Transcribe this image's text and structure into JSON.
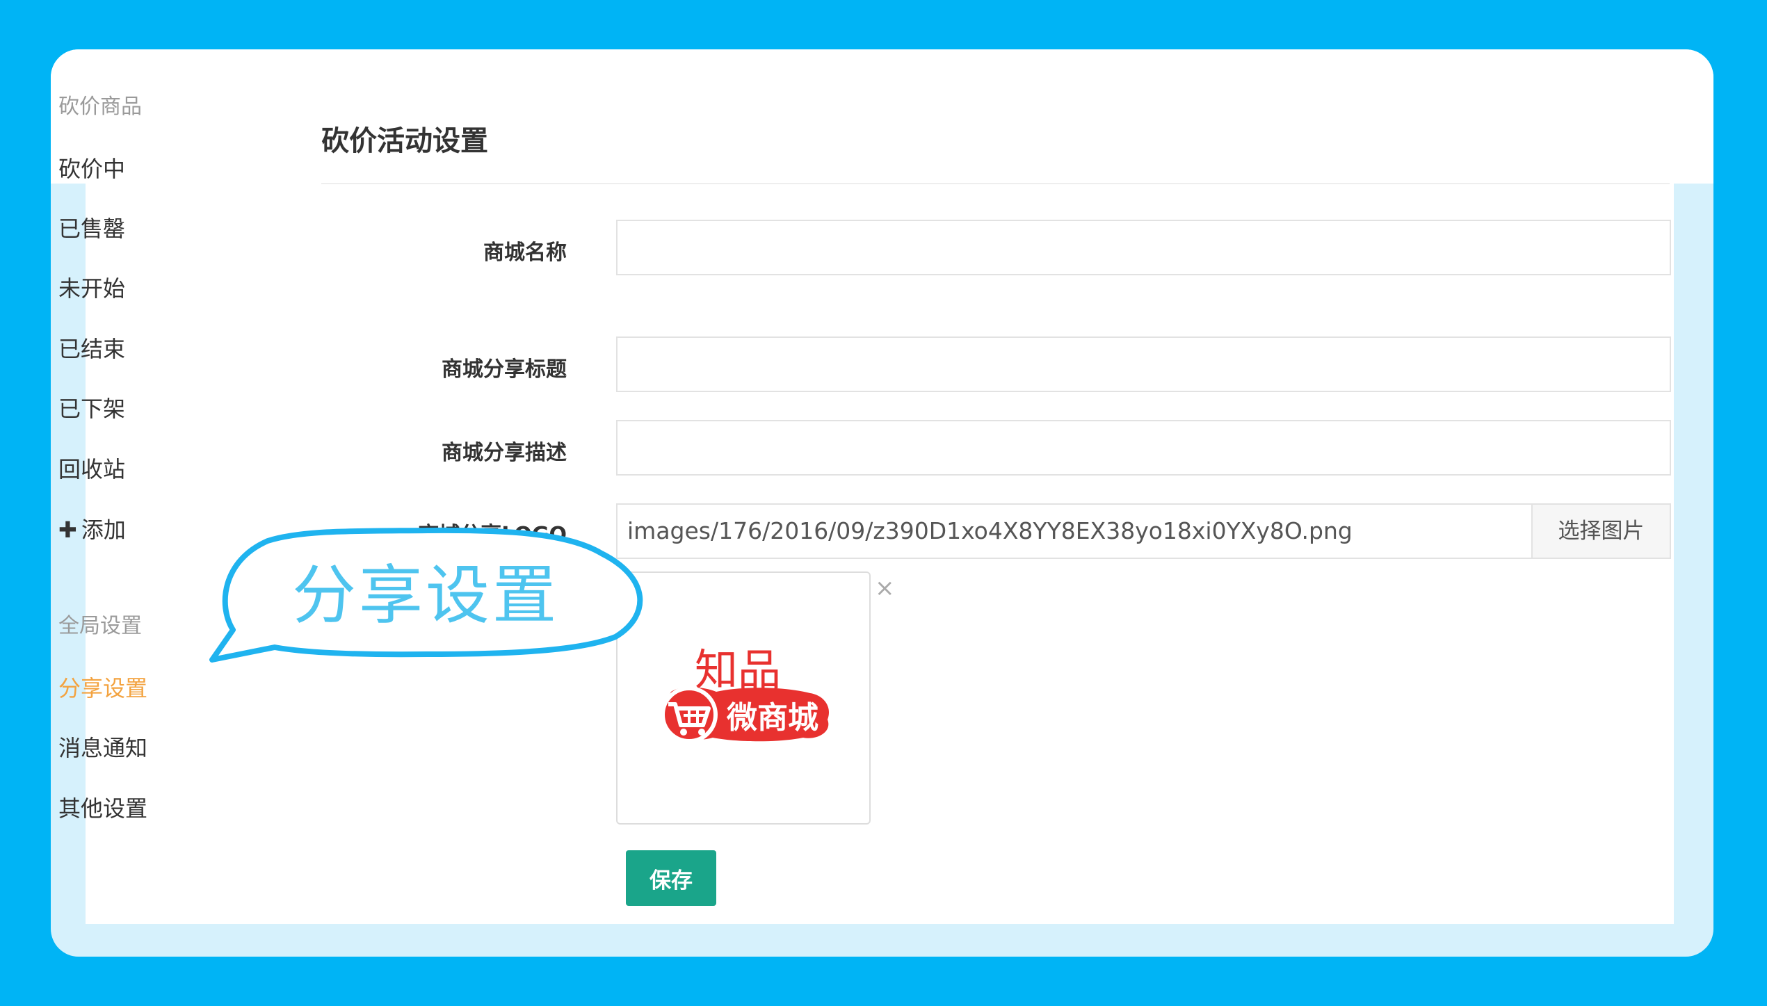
{
  "sidebar": {
    "group1_title": "砍价商品",
    "items": [
      {
        "label": "砍价中"
      },
      {
        "label": "已售罄"
      },
      {
        "label": "未开始"
      },
      {
        "label": "已结束"
      },
      {
        "label": "已下架"
      },
      {
        "label": "回收站"
      },
      {
        "label": "添加",
        "icon": "plus-icon"
      }
    ],
    "group2_title": "全局设置",
    "settings": [
      {
        "label": "分享设置",
        "active": true
      },
      {
        "label": "消息通知"
      },
      {
        "label": "其他设置"
      }
    ]
  },
  "page": {
    "title": "砍价活动设置"
  },
  "form": {
    "shop_name_label": "商城名称",
    "shop_name_value": "",
    "share_title_label": "商城分享标题",
    "share_title_value": "",
    "share_desc_label": "商城分享描述",
    "share_desc_value": "",
    "share_logo_label": "商城分享LOGO",
    "share_logo_path": "images/176/2016/09/z390D1xo4X8YY8EX38yo18xi0YXy8O.png",
    "choose_image_label": "选择图片",
    "remove_image_label": "×",
    "save_label": "保存"
  },
  "logo": {
    "top_text": "知品",
    "bottom_text": "微商城"
  },
  "callout": {
    "text": "分享设置"
  },
  "colors": {
    "background": "#00b4f5",
    "active_item": "#f3a340",
    "save_button": "#1aa58a",
    "logo_red": "#e8312f",
    "callout_stroke": "#1fb3ef"
  }
}
